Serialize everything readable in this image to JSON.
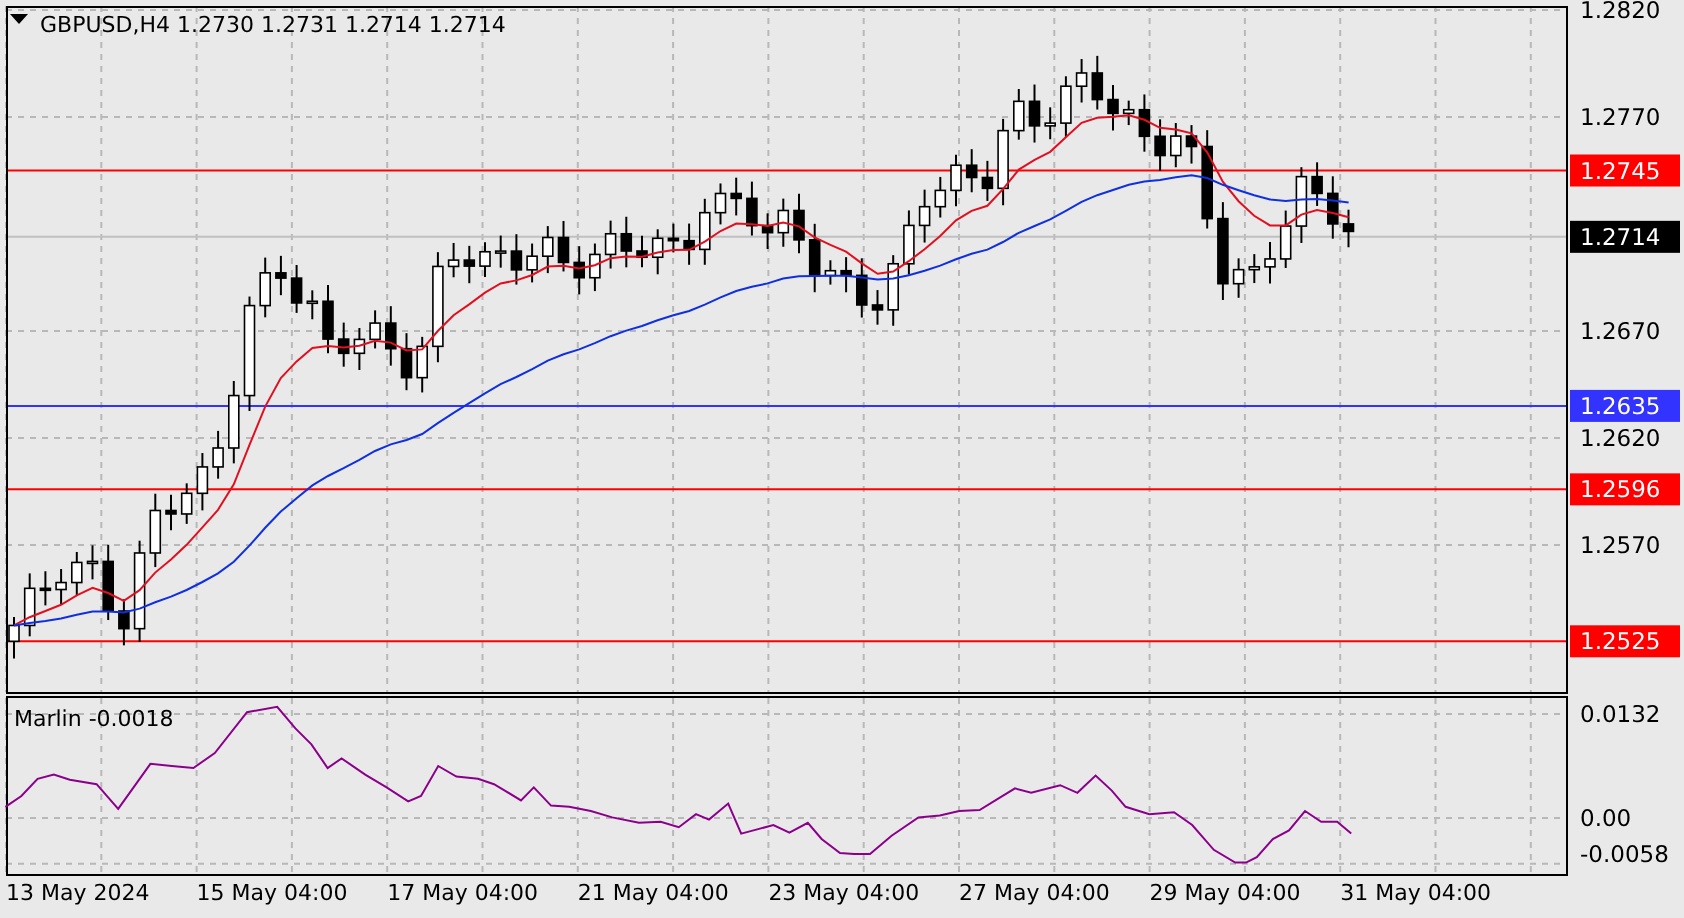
{
  "header": {
    "title": "GBPUSD,H4  1.2730 1.2731 1.2714 1.2714"
  },
  "price_axis": {
    "ticks": [
      "1.2820",
      "1.2770",
      "1.2670",
      "1.2620",
      "1.2570"
    ]
  },
  "levels": [
    {
      "price": "1.2745",
      "color": "#ff0000"
    },
    {
      "price": "1.2635",
      "color": "#3333ff"
    },
    {
      "price": "1.2596",
      "color": "#ff0000"
    },
    {
      "price": "1.2525",
      "color": "#ff0000"
    }
  ],
  "current_price": {
    "price": "1.2714"
  },
  "indicator": {
    "label": "Marlin -0.0018",
    "ticks": [
      "0.0132",
      "0.00",
      "-0.0058"
    ]
  },
  "time_axis": {
    "labels": [
      "13 May 2024",
      "15 May 04:00",
      "17 May 04:00",
      "21 May 04:00",
      "23 May 04:00",
      "27 May 04:00",
      "29 May 04:00",
      "31 May 04:00"
    ]
  }
}
